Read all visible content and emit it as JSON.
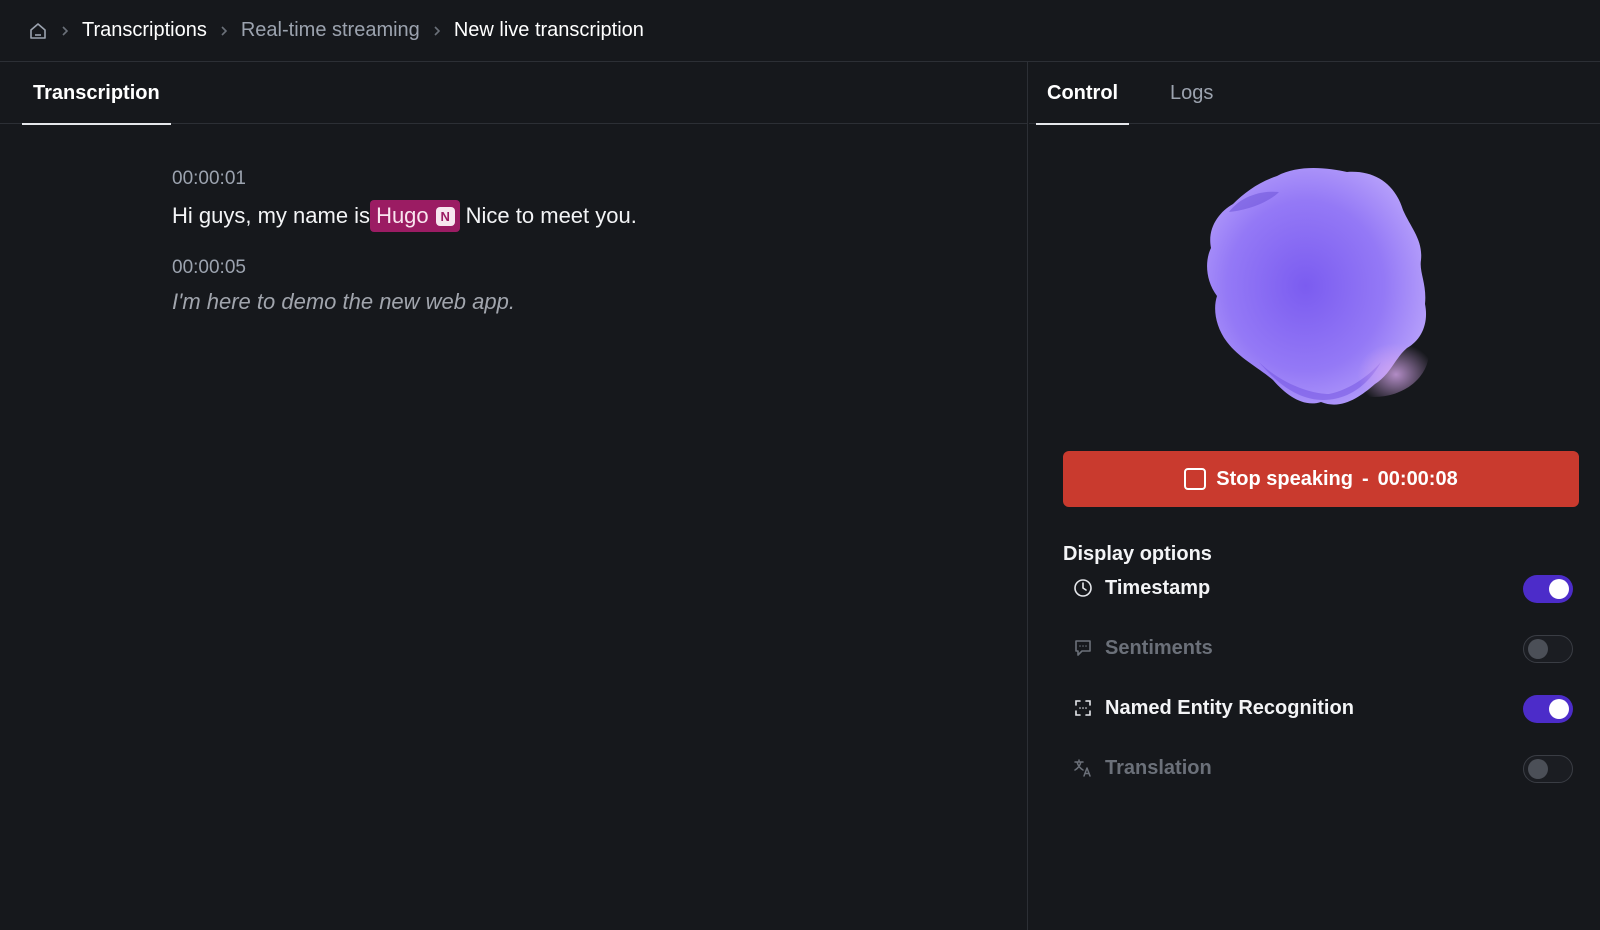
{
  "breadcrumb": {
    "items": [
      {
        "label": "Transcriptions"
      },
      {
        "label": "Real-time streaming"
      },
      {
        "label": "New live transcription"
      }
    ]
  },
  "left_panel": {
    "tab": "Transcription",
    "segments": [
      {
        "timestamp": "00:00:01",
        "text_before": "Hi guys, my name is",
        "entity": "Hugo",
        "entity_badge": "N",
        "text_after": "Nice to meet you."
      },
      {
        "timestamp": "00:00:05",
        "text": "I'm here to demo the new web app."
      }
    ]
  },
  "right_panel": {
    "tabs": [
      {
        "label": "Control",
        "active": true
      },
      {
        "label": "Logs",
        "active": false
      }
    ],
    "stop_button": {
      "label": "Stop speaking",
      "separator": "-",
      "elapsed": "00:00:08",
      "color": "#c93a2e"
    },
    "display_options": {
      "title": "Display options",
      "options": [
        {
          "label": "Timestamp",
          "icon": "clock-icon",
          "enabled": true
        },
        {
          "label": "Sentiments",
          "icon": "comment-icon",
          "enabled": false
        },
        {
          "label": "Named Entity Recognition",
          "icon": "entity-scan-icon",
          "enabled": true
        },
        {
          "label": "Translation",
          "icon": "translate-icon",
          "enabled": false
        }
      ]
    }
  },
  "colors": {
    "background": "#16181c",
    "accent": "#4c2cc9",
    "entity_highlight": "#9b1c63",
    "blob": "#8b6ff5"
  }
}
